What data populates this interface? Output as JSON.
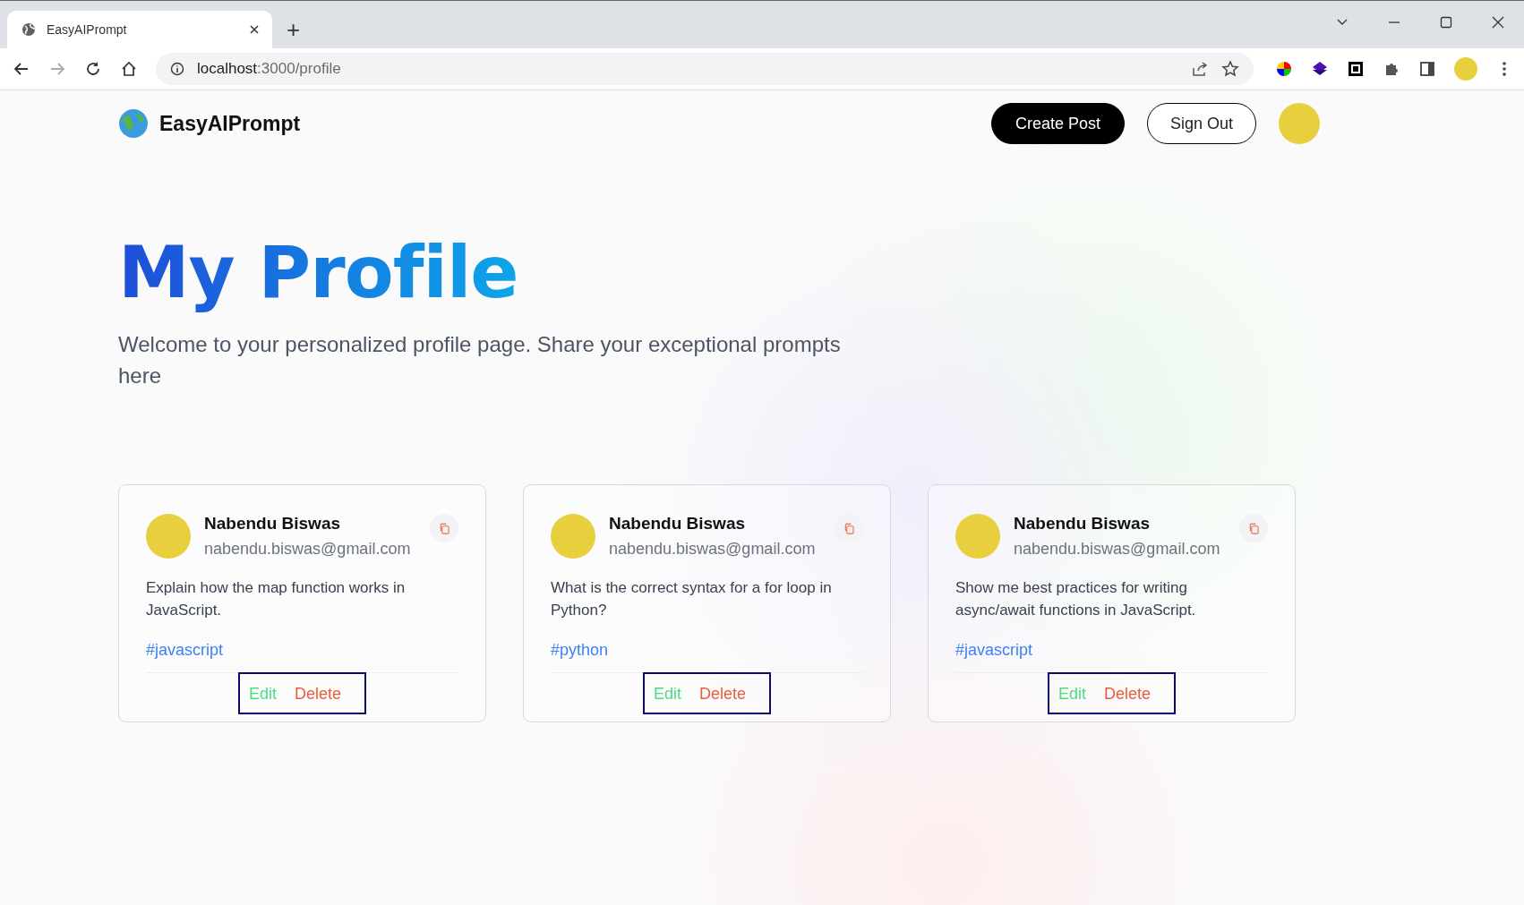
{
  "browser": {
    "tab_title": "EasyAIPrompt",
    "new_tab": "+",
    "address": {
      "host": "localhost",
      "path": ":3000/profile"
    }
  },
  "nav": {
    "brand": "EasyAIPrompt",
    "create_button": "Create Post",
    "signout_button": "Sign Out"
  },
  "hero": {
    "title": "My Profile",
    "description": "Welcome to your personalized profile page. Share your exceptional prompts here"
  },
  "posts": [
    {
      "name": "Nabendu Biswas",
      "email": "nabendu.biswas@gmail.com",
      "prompt": "Explain how the map function works in JavaScript.",
      "tag": "#javascript",
      "edit": "Edit",
      "delete": "Delete"
    },
    {
      "name": "Nabendu Biswas",
      "email": "nabendu.biswas@gmail.com",
      "prompt": "What is the correct syntax for a for loop in Python?",
      "tag": "#python",
      "edit": "Edit",
      "delete": "Delete"
    },
    {
      "name": "Nabendu Biswas",
      "email": "nabendu.biswas@gmail.com",
      "prompt": "Show me best practices for writing async/await functions in JavaScript.",
      "tag": "#javascript",
      "edit": "Edit",
      "delete": "Delete"
    }
  ]
}
